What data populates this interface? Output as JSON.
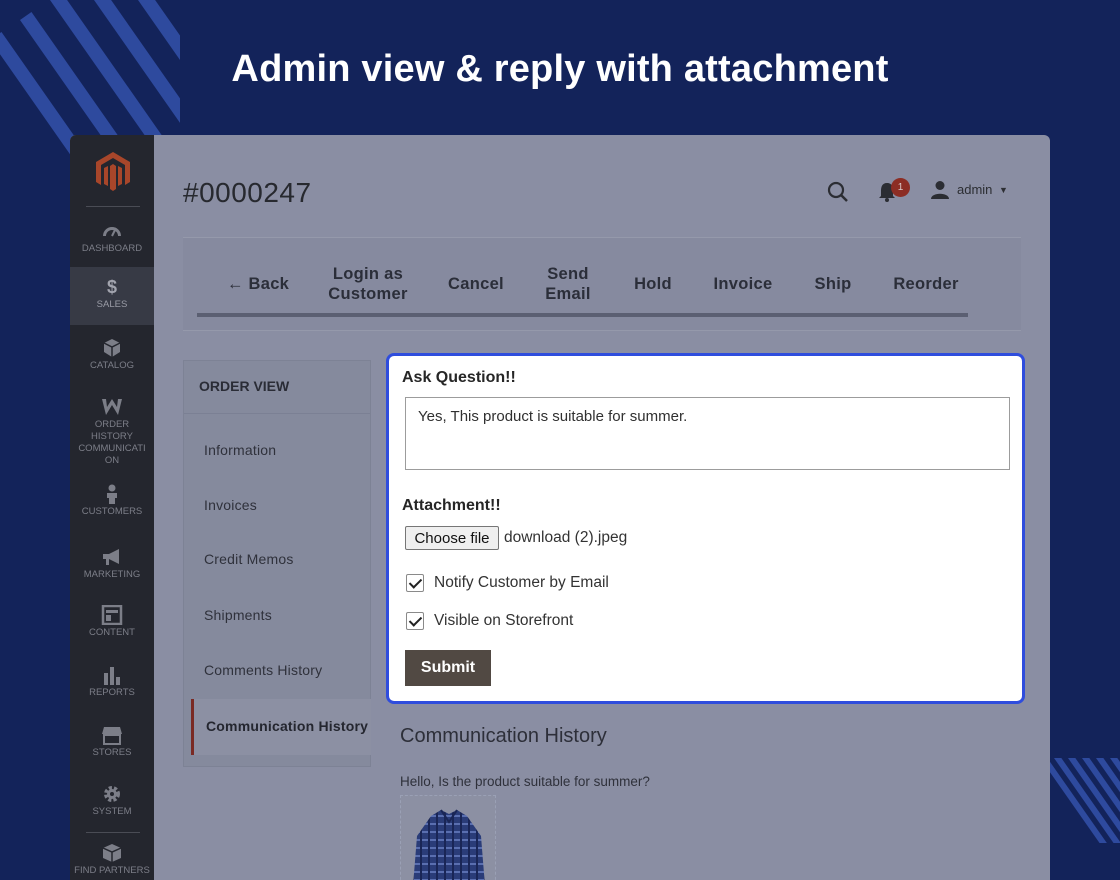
{
  "headline": "Admin view & reply with attachment",
  "sidebar": {
    "items": [
      {
        "label": "DASHBOARD",
        "icon": "dashboard-icon"
      },
      {
        "label": "SALES",
        "icon": "dollar-icon"
      },
      {
        "label": "CATALOG",
        "icon": "cube-icon"
      },
      {
        "label": "ORDER HISTORY COMMUNICATI ON",
        "icon": "w-icon"
      },
      {
        "label": "CUSTOMERS",
        "icon": "person-icon"
      },
      {
        "label": "MARKETING",
        "icon": "megaphone-icon"
      },
      {
        "label": "CONTENT",
        "icon": "layout-icon"
      },
      {
        "label": "REPORTS",
        "icon": "bar-chart-icon"
      },
      {
        "label": "STORES",
        "icon": "store-icon"
      },
      {
        "label": "SYSTEM",
        "icon": "gear-icon"
      },
      {
        "label": "FIND PARTNERS",
        "icon": "box-icon"
      }
    ]
  },
  "header": {
    "order_number": "#0000247",
    "notification_count": "1",
    "username": "admin"
  },
  "toolbar": {
    "back": "Back",
    "login_as_customer": "Login as Customer",
    "cancel": "Cancel",
    "send_email": "Send Email",
    "hold": "Hold",
    "invoice": "Invoice",
    "ship": "Ship",
    "reorder": "Reorder"
  },
  "order_view": {
    "title": "ORDER VIEW",
    "items": [
      {
        "label": "Information"
      },
      {
        "label": "Invoices"
      },
      {
        "label": "Credit Memos"
      },
      {
        "label": "Shipments"
      },
      {
        "label": "Comments History"
      },
      {
        "label": "Communication History"
      }
    ]
  },
  "form": {
    "question_label": "Ask Question!!",
    "question_value": "Yes, This product is suitable for summer.",
    "attachment_label": "Attachment!!",
    "choose_file_label": "Choose file",
    "file_name": "download (2).jpeg",
    "notify_label": "Notify Customer by Email",
    "visible_label": "Visible on Storefront",
    "submit_label": "Submit"
  },
  "communication": {
    "title": "Communication History",
    "message": "Hello, Is the product suitable for summer?"
  },
  "colors": {
    "background": "#13235a",
    "highlight": "#2f4ddd",
    "submit": "#514943"
  }
}
